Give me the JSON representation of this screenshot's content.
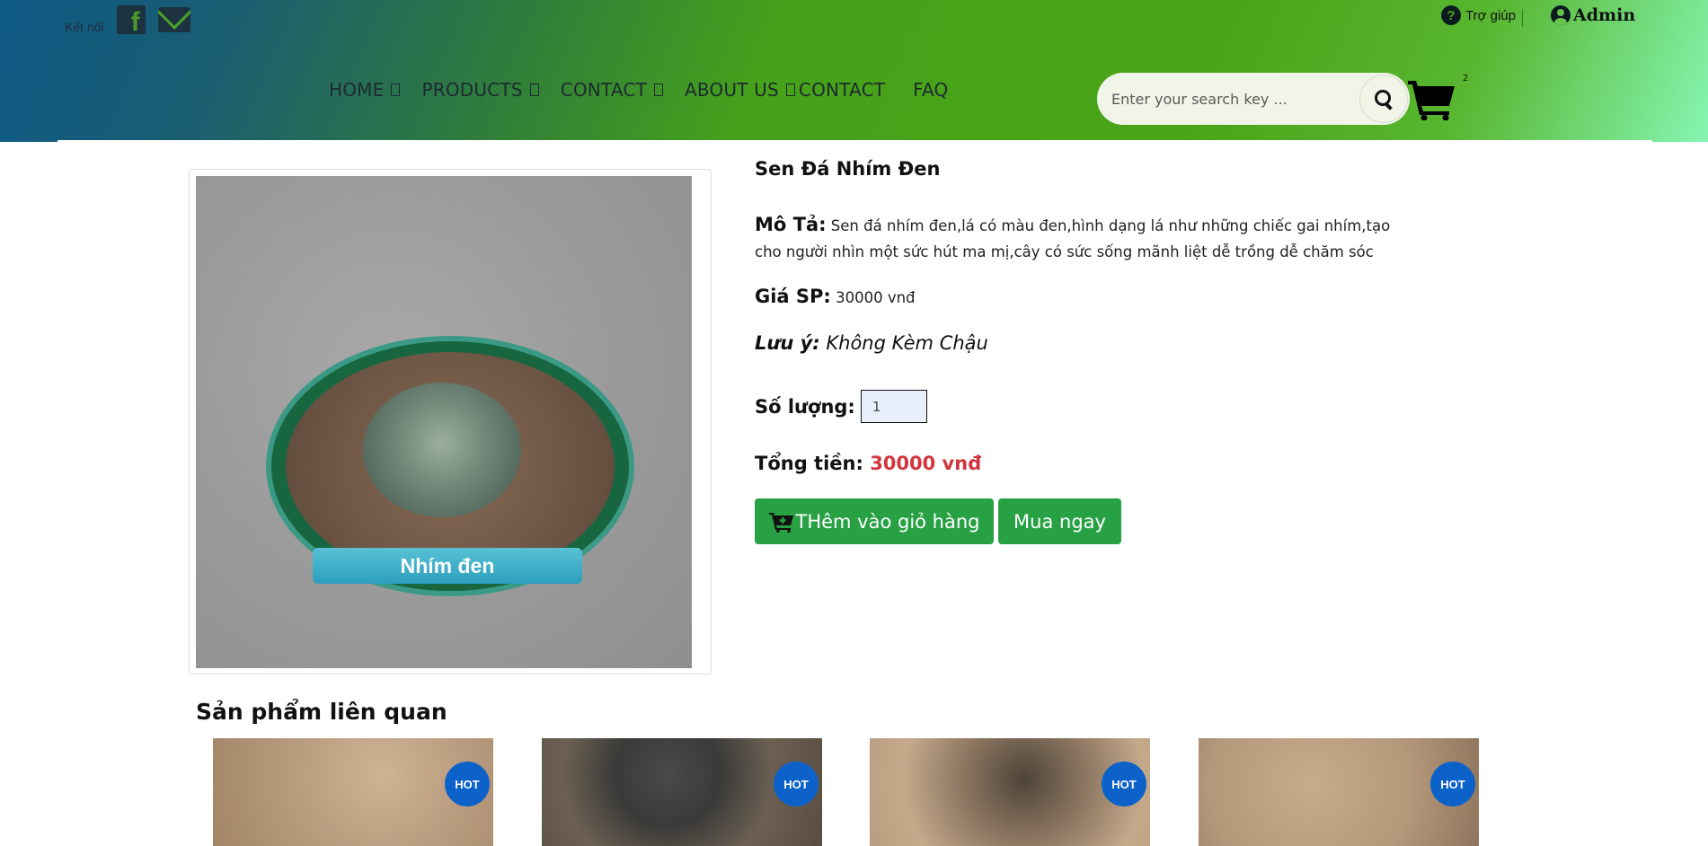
{
  "topbar": {
    "connect_label": "Kết nối",
    "help_label": "Trợ giúp",
    "admin_label": "Admin",
    "social_icons": [
      "facebook-icon",
      "mail-icon"
    ]
  },
  "nav": {
    "items": [
      {
        "label": "HOME",
        "has_dropdown": true
      },
      {
        "label": "PRODUCTS",
        "has_dropdown": true
      },
      {
        "label": "CONTACT",
        "has_dropdown": true
      },
      {
        "label": "ABOUT US",
        "has_dropdown": true
      },
      {
        "label": "CONTACT",
        "has_dropdown": false
      },
      {
        "label": "FAQ",
        "has_dropdown": false
      }
    ]
  },
  "search": {
    "placeholder": "Enter your search key ...",
    "value": ""
  },
  "cart": {
    "count": "2"
  },
  "product": {
    "image_caption": "Nhím đen",
    "title": "Sen Đá Nhím Đen",
    "desc_label": "Mô Tả:",
    "desc_text": "Sen đá nhím đen,lá có màu đen,hình dạng lá như những chiếc gai nhím,tạo cho người nhìn một sức hút ma mị,cây có sức sống mãnh liệt dễ trồng dễ chăm sóc",
    "price_label": "Giá SP:",
    "price_value": "30000 vnđ",
    "note_label": "Lưu ý:",
    "note_text": "Không Kèm Chậu",
    "qty_label": "Số lượng:",
    "qty_value": "1",
    "total_label": "Tổng tiền:",
    "total_value": "30000 vnđ",
    "add_to_cart_label": "THêm vào giỏ hàng",
    "buy_now_label": "Mua ngay"
  },
  "related": {
    "title": "Sản phẩm liên quan",
    "badge_label": "HOT",
    "items": [
      {
        "badge": "HOT"
      },
      {
        "badge": "HOT"
      },
      {
        "badge": "HOT"
      },
      {
        "badge": "HOT"
      }
    ]
  },
  "colors": {
    "accent_green": "#28a145",
    "total_red": "#d2353e",
    "hot_badge_blue": "#0c62c9"
  }
}
